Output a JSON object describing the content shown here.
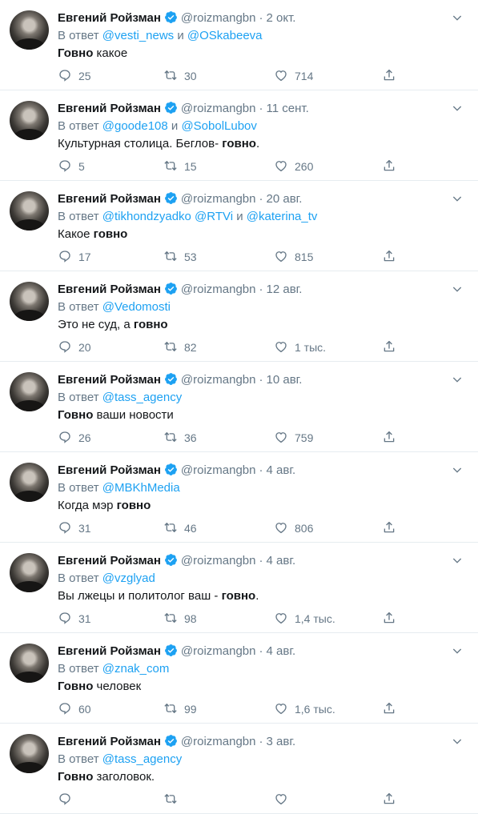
{
  "colors": {
    "accent": "#1da1f2",
    "muted": "#657786",
    "text": "#14171a"
  },
  "icons": {
    "reply": "reply-icon",
    "retweet": "retweet-icon",
    "like": "heart-icon",
    "share": "share-icon",
    "verified": "verified-icon",
    "caret": "chevron-down-icon"
  },
  "tweets": [
    {
      "name": "Евгений Ройзман",
      "handle": "@roizmangbn",
      "date": "2 окт.",
      "reply_prefix": "В ответ ",
      "mentions": [
        "@vesti_news",
        "@OSkabeeva"
      ],
      "mention_joiners": [
        " и "
      ],
      "text_bold_before": "Говно",
      "text_plain": " какое",
      "text_bold_after": "",
      "text_tail": "",
      "replies": "25",
      "retweets": "30",
      "likes": "714"
    },
    {
      "name": "Евгений Ройзман",
      "handle": "@roizmangbn",
      "date": "11 сент.",
      "reply_prefix": "В ответ ",
      "mentions": [
        "@goode108",
        "@SobolLubov"
      ],
      "mention_joiners": [
        " и "
      ],
      "text_bold_before": "",
      "text_plain": "Культурная столица. Беглов- ",
      "text_bold_after": "говно",
      "text_tail": ".",
      "replies": "5",
      "retweets": "15",
      "likes": "260"
    },
    {
      "name": "Евгений Ройзман",
      "handle": "@roizmangbn",
      "date": "20 авг.",
      "reply_prefix": "В ответ ",
      "mentions": [
        "@tikhondzyadko",
        "@RTVi",
        "@katerina_tv"
      ],
      "mention_joiners": [
        " ",
        " и "
      ],
      "text_bold_before": "",
      "text_plain": "Какое ",
      "text_bold_after": "говно",
      "text_tail": "",
      "replies": "17",
      "retweets": "53",
      "likes": "815"
    },
    {
      "name": "Евгений Ройзман",
      "handle": "@roizmangbn",
      "date": "12 авг.",
      "reply_prefix": "В ответ ",
      "mentions": [
        "@Vedomosti"
      ],
      "mention_joiners": [],
      "text_bold_before": "",
      "text_plain": "Это не суд, а ",
      "text_bold_after": "говно",
      "text_tail": "",
      "replies": "20",
      "retweets": "82",
      "likes": "1 тыс."
    },
    {
      "name": "Евгений Ройзман",
      "handle": "@roizmangbn",
      "date": "10 авг.",
      "reply_prefix": "В ответ ",
      "mentions": [
        "@tass_agency"
      ],
      "mention_joiners": [],
      "text_bold_before": "Говно",
      "text_plain": " ваши новости",
      "text_bold_after": "",
      "text_tail": "",
      "replies": "26",
      "retweets": "36",
      "likes": "759"
    },
    {
      "name": "Евгений Ройзман",
      "handle": "@roizmangbn",
      "date": "4 авг.",
      "reply_prefix": "В ответ ",
      "mentions": [
        "@MBKhMedia"
      ],
      "mention_joiners": [],
      "text_bold_before": "",
      "text_plain": "Когда мэр ",
      "text_bold_after": "говно",
      "text_tail": "",
      "replies": "31",
      "retweets": "46",
      "likes": "806"
    },
    {
      "name": "Евгений Ройзман",
      "handle": "@roizmangbn",
      "date": "4 авг.",
      "reply_prefix": "В ответ ",
      "mentions": [
        "@vzglyad"
      ],
      "mention_joiners": [],
      "text_bold_before": "",
      "text_plain": "Вы лжецы и политолог ваш - ",
      "text_bold_after": "говно",
      "text_tail": ".",
      "replies": "31",
      "retweets": "98",
      "likes": "1,4 тыс."
    },
    {
      "name": "Евгений Ройзман",
      "handle": "@roizmangbn",
      "date": "4 авг.",
      "reply_prefix": "В ответ ",
      "mentions": [
        "@znak_com"
      ],
      "mention_joiners": [],
      "text_bold_before": "Говно",
      "text_plain": " человек",
      "text_bold_after": "",
      "text_tail": "",
      "replies": "60",
      "retweets": "99",
      "likes": "1,6 тыс."
    },
    {
      "name": "Евгений Ройзман",
      "handle": "@roizmangbn",
      "date": "3 авг.",
      "reply_prefix": "В ответ ",
      "mentions": [
        "@tass_agency"
      ],
      "mention_joiners": [],
      "text_bold_before": "Говно",
      "text_plain": " заголовок.",
      "text_bold_after": "",
      "text_tail": "",
      "replies": "",
      "retweets": "",
      "likes": ""
    }
  ]
}
